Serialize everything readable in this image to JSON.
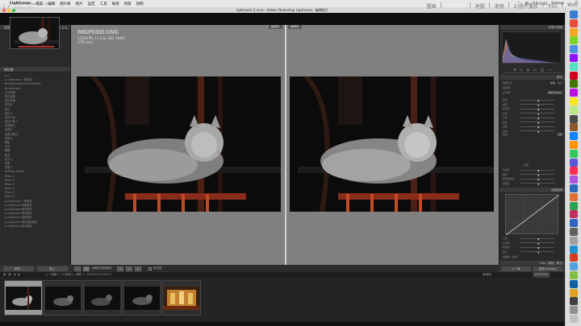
{
  "menubar": {
    "app": "Lightroom",
    "items": [
      "檔案",
      "編輯",
      "相片庫",
      "相片",
      "設定",
      "工具",
      "檢視",
      "視窗",
      "說明"
    ],
    "clock": "週一下午4:42",
    "user": "kennyc"
  },
  "window": {
    "title": "lightroom-2.lrcat - Adobe Photoshop Lightroom - 編輯相片"
  },
  "lr": {
    "logo": "Lr",
    "id_line1": "Adobe Lightroom CC 2015",
    "id_line2": "kenny chu",
    "modules": [
      "圖庫",
      "編輯相片",
      "地圖",
      "書冊",
      "幻燈片播放",
      "列印",
      "Web"
    ],
    "active_module": "編輯相片"
  },
  "left_panel": {
    "navigator_label": "導覽器",
    "navigator_opts": [
      "適合",
      "填滿",
      "1:1"
    ],
    "presets_label": "預設集",
    "preset_rows": [
      "► Lr",
      "► Lightroom 一般預設",
      "▼ Lookforward.net Wedding",
      "  ▼ Lightroom",
      "      工作風格",
      "      黑白風格",
      "      復古風格",
      "      寶石色",
      "      夏日",
      "      夏日 2",
      "      夏日午後",
      "      夏日午後 2",
      "      香港復古",
      "      高對比",
      "      高對比黑白",
      "      低對比",
      "      暖色",
      "      冷色",
      "      銀鹽",
      "      韓式",
      "      韓式 2",
      "      清新",
      "      清新 2",
      "  ▼ Retro_Preset",
      "      Retro_1",
      "      Retro_2",
      "      Retro_3",
      "      Retro_4",
      "      Retro_5",
      "      Retro_6",
      "► Lightroom 一般預設",
      "► Lightroom 效果預設",
      "► Lightroom 曝光預設",
      "► Lightroom 黑白預設",
      "► Lightroom 銳利預設",
      "► Lightroom 黑白濾鏡預設",
      "► Lightroom 影片預設"
    ],
    "copy_button": "拷貝...",
    "paste_button": "貼上"
  },
  "center": {
    "image_title": "IMGP0300.DNG",
    "exif": "1/320 秒, f / 2.8, ISO 1600",
    "focal": "170 mm",
    "before_label": "編輯前",
    "after_label": "編輯後"
  },
  "toolbar": {
    "view_label": "YY",
    "mode_label": "編輯前與編輯後：",
    "soft_proof": "軟校樣"
  },
  "right_panel": {
    "histogram_label": "色階分佈圖",
    "basic_label": "基本",
    "treatment": "處理方式",
    "color_opt": "彩色",
    "bw_opt": "黑白",
    "profile": "設定檔",
    "wb_label": "白平衡",
    "wb_value": "相機原始設定",
    "tone_label": "色調",
    "auto_label": "自動",
    "presence_label": "外觀",
    "sliders_basic": [
      "色溫",
      "色調",
      "曝光度",
      "對比",
      "亮部",
      "陰影",
      "白色",
      "黑色"
    ],
    "sliders_presence": [
      "清晰度",
      "細節",
      "自然飽和度",
      "飽和度"
    ],
    "tone_curve_label": "色調曲線",
    "curve_sliders": [
      "亮部",
      "亮色調",
      "暗色調",
      "陰影"
    ],
    "point_curve": "點曲線：線性",
    "hsl_label": "HSL / 顏色 / 黑白",
    "hsl_tabs": [
      "色相",
      "飽和度",
      "明亮度",
      "全部"
    ],
    "prev_button": "上一個",
    "reset_button": "重設 (Adobe)"
  },
  "filmstrip": {
    "path": "上一個匯入  /  4 張相片 / 選取 1 / IMGP0300.DNG ▾",
    "filter_label": "篩選器：",
    "filter_value": "關閉篩選器"
  }
}
